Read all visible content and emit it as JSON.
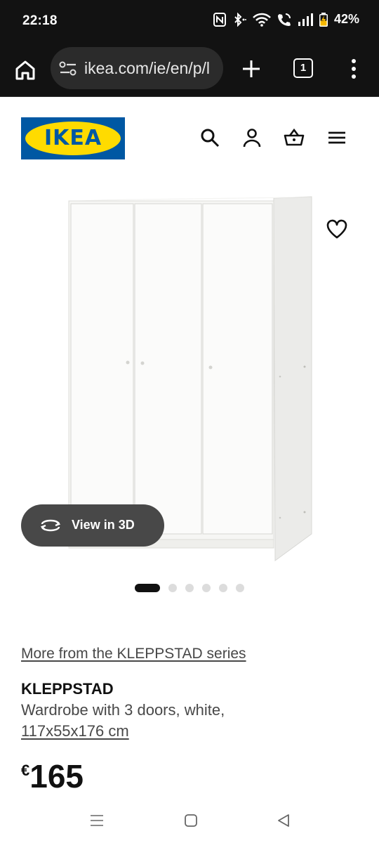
{
  "status_bar": {
    "time": "22:18",
    "battery": "42%",
    "icons": [
      "nfc-icon",
      "bluetooth-icon",
      "wifi-icon",
      "wifi-calling-icon",
      "signal-icon",
      "battery-charging-icon"
    ]
  },
  "browser": {
    "url": "ikea.com/ie/en/p/l",
    "tab_count": "1",
    "icons": [
      "home-icon",
      "site-settings-icon",
      "plus-icon",
      "tabs-icon",
      "more-vert-icon"
    ]
  },
  "header": {
    "logo_text": "IKEA",
    "icons": [
      "search-icon",
      "user-icon",
      "basket-icon",
      "hamburger-icon"
    ],
    "colors": {
      "logo_blue": "#0058a3",
      "logo_yellow": "#ffdb00"
    }
  },
  "gallery": {
    "view3d_label": "View in 3D",
    "dot_count": 6,
    "active_dot": 0
  },
  "product": {
    "series_link": "More from the KLEPPSTAD series",
    "name": "KLEPPSTAD",
    "description": "Wardrobe with 3 doors, white,",
    "size": "117x55x176 cm",
    "currency": "€",
    "price": "165"
  },
  "nav": {
    "icons": [
      "recents-icon",
      "home-nav-icon",
      "back-icon"
    ]
  }
}
